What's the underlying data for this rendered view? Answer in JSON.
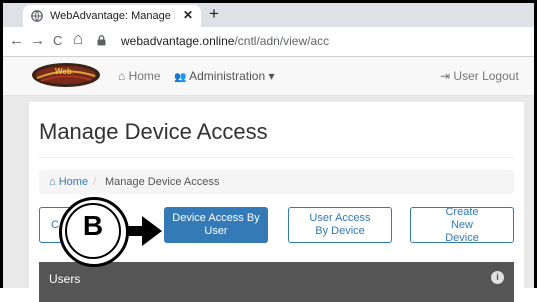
{
  "browser": {
    "tab_title": "WebAdvantage: Manage Device",
    "tab_close": "✕",
    "new_tab": "+",
    "back": "←",
    "forward": "→",
    "reload": "C",
    "home": "⌂",
    "url_host": "webadvantage.online",
    "url_path": "/cntl/adn/view/acc"
  },
  "navbar": {
    "logo_text": "Web",
    "home_icon": "⌂",
    "home_label": "Home",
    "admin_icon": "👥",
    "admin_label": "Administration",
    "admin_caret": "▾",
    "logout_icon": "⇥",
    "logout_label": "User Logout"
  },
  "page": {
    "title": "Manage Device Access",
    "breadcrumb": {
      "home_icon": "⌂",
      "home": "Home",
      "sep": "/",
      "current": "Manage Device Access"
    },
    "buttons": [
      {
        "label": "C"
      },
      {
        "label": "Device Access By User"
      },
      {
        "label": "User Access By Device"
      },
      {
        "label": "Create New Device"
      }
    ],
    "users_header": "Users",
    "info_icon": "i"
  },
  "callout": {
    "letter": "B"
  },
  "colors": {
    "primary": "#337ab7",
    "panel_header": "#555555",
    "background": "#e9e9e9"
  }
}
